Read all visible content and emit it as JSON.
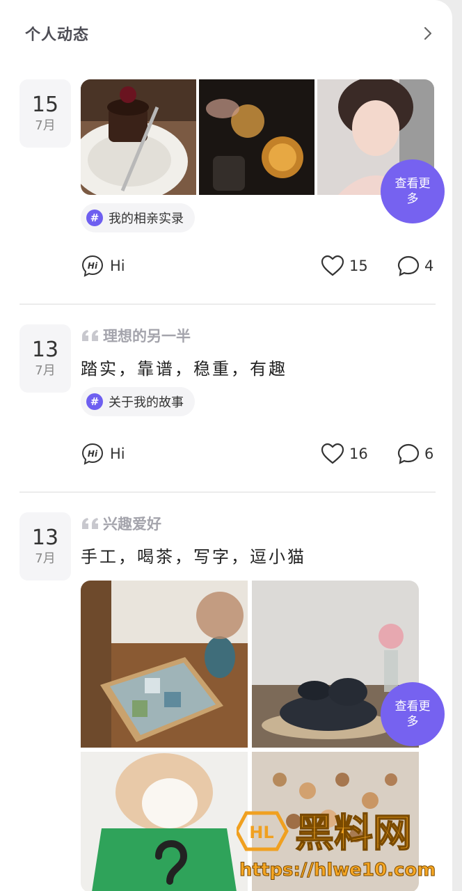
{
  "header": {
    "title": "个人动态"
  },
  "posts": [
    {
      "day": "15",
      "month": "7月",
      "more": "查看更多",
      "tag": "我的相亲实录",
      "hi": "Hi",
      "likes": "15",
      "comments": "4"
    },
    {
      "day": "13",
      "month": "7月",
      "quote_title": "理想的另一半",
      "text": "踏实，靠谱，稳重，有趣",
      "tag": "关于我的故事",
      "hi": "Hi",
      "likes": "16",
      "comments": "6"
    },
    {
      "day": "13",
      "month": "7月",
      "quote_title": "兴趣爱好",
      "text": "手工，喝茶，写字，逗小猫",
      "more": "查看更多"
    }
  ],
  "watermark": {
    "brand": "黑料网",
    "url": "https://hlwe10.com"
  },
  "colors": {
    "accent": "#7662f0",
    "tag_icon": "#6e5ff0",
    "muted": "#a4a4ac"
  }
}
